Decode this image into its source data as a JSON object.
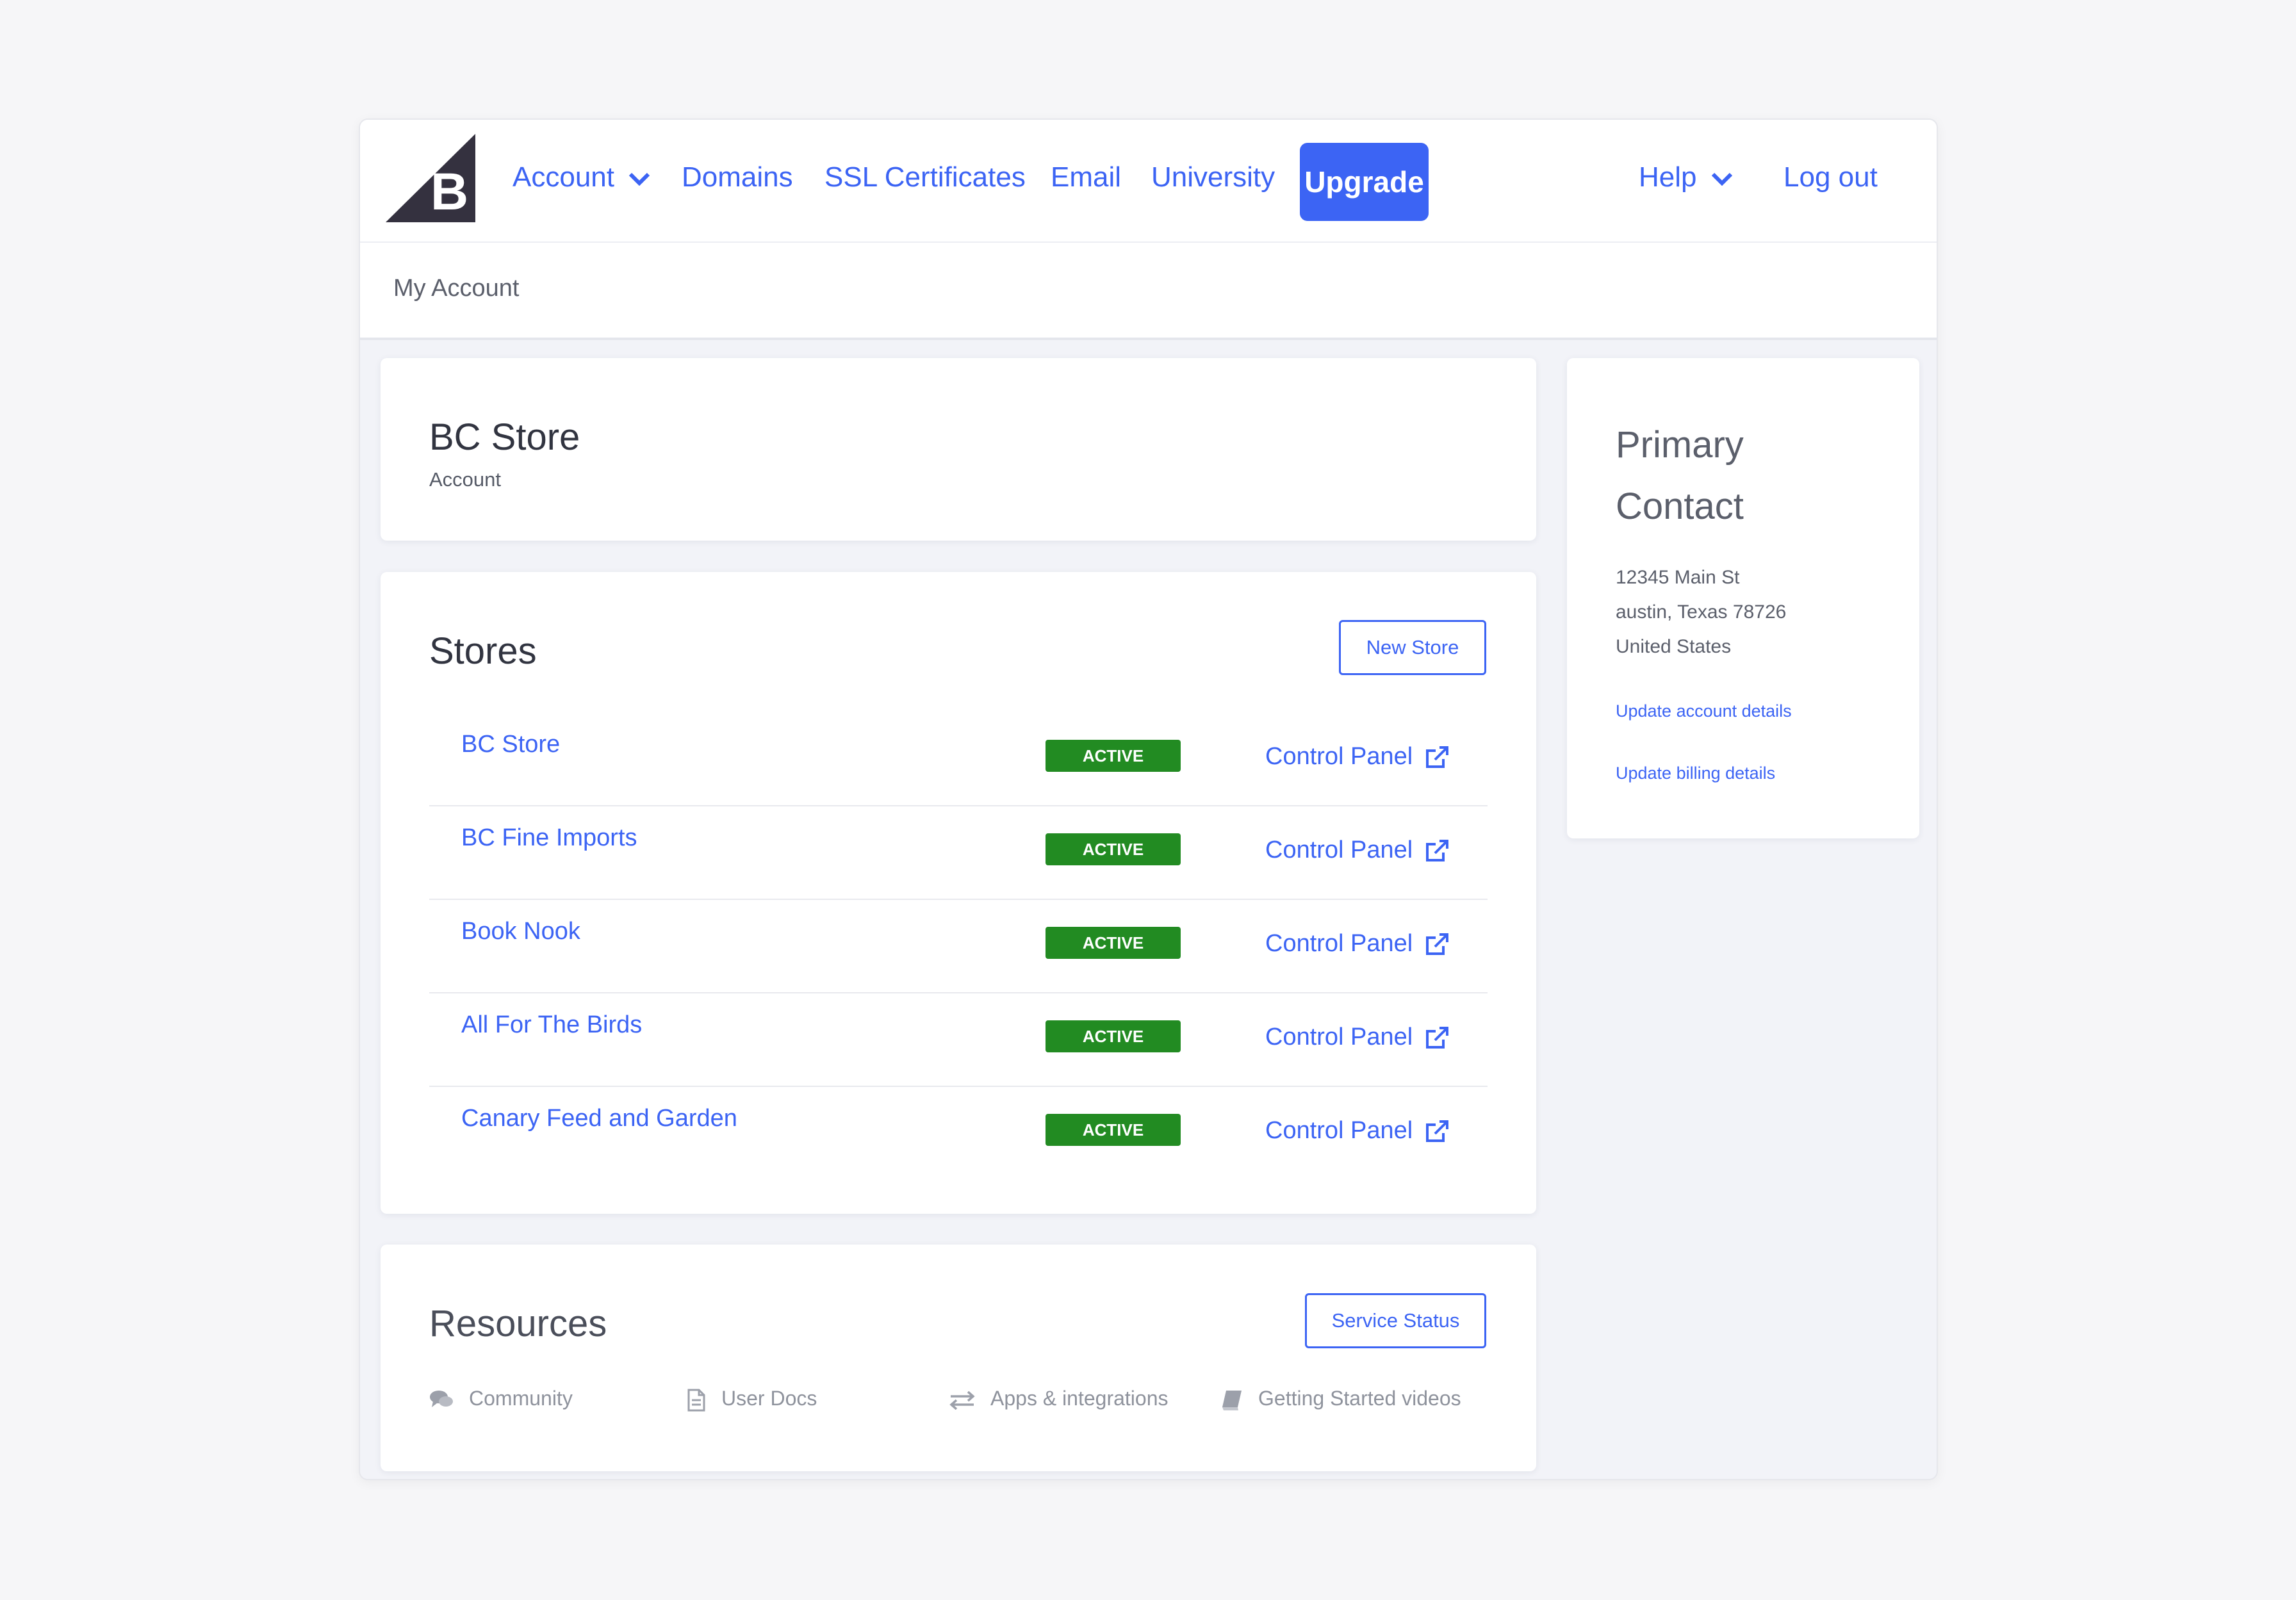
{
  "nav": {
    "account": "Account",
    "domains": "Domains",
    "ssl": "SSL Certificates",
    "email": "Email",
    "university": "University",
    "upgrade": "Upgrade",
    "help": "Help",
    "logout": "Log out"
  },
  "breadcrumb": "My Account",
  "account_card": {
    "title": "BC Store",
    "subtitle": "Account"
  },
  "stores": {
    "title": "Stores",
    "new_store": "New Store",
    "items": [
      {
        "name": "BC Store",
        "status": "ACTIVE",
        "link": "Control Panel"
      },
      {
        "name": "BC Fine Imports",
        "status": "ACTIVE",
        "link": "Control Panel"
      },
      {
        "name": "Book Nook",
        "status": "ACTIVE",
        "link": "Control Panel"
      },
      {
        "name": "All For The Birds",
        "status": "ACTIVE",
        "link": "Control Panel"
      },
      {
        "name": "Canary Feed and Garden",
        "status": "ACTIVE",
        "link": "Control Panel"
      }
    ]
  },
  "resources": {
    "title": "Resources",
    "service_status": "Service Status",
    "links": [
      {
        "label": "Community",
        "icon": "comments-icon"
      },
      {
        "label": "User Docs",
        "icon": "document-icon"
      },
      {
        "label": "Apps & integrations",
        "icon": "exchange-icon"
      },
      {
        "label": "Getting Started videos",
        "icon": "book-icon"
      }
    ]
  },
  "contact": {
    "title": "Primary Contact",
    "address_line1": "12345 Main St",
    "address_line2": "austin, Texas 78726",
    "address_line3": "United States",
    "update_account": "Update account details",
    "update_billing": "Update billing details"
  },
  "colors": {
    "accent": "#3c64f4",
    "active_badge": "#228b22",
    "background": "#f2f3f8"
  }
}
